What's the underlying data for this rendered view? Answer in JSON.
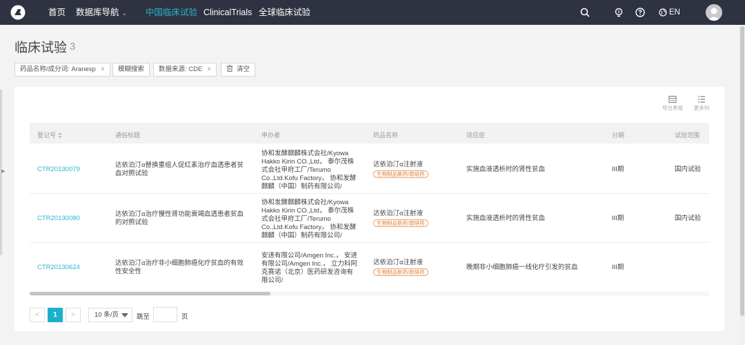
{
  "nav": {
    "home": "首页",
    "db_nav": "数据库导航",
    "cn_trials": "中国临床试验",
    "clinicaltrials": "ClinicalTrials",
    "global_trials": "全球临床试验",
    "lang": "EN"
  },
  "page": {
    "title": "临床试验",
    "count": "3"
  },
  "filters": {
    "drug": "药品名称/成分词: Aranesp",
    "fuzzy": "模糊搜索",
    "source": "数据来源: CDE",
    "clear": "清空"
  },
  "toolbar": {
    "export": "导出表格",
    "more_cols": "更多列"
  },
  "table": {
    "headers": {
      "reg": "登记号",
      "title": "通俗标题",
      "sponsor": "申办者",
      "drug": "药品名称",
      "indication": "适应症",
      "phase": "分期",
      "scope": "试验范围"
    },
    "rows": [
      {
        "reg": "CTR20130079",
        "title": "达依泊汀α替换重组人促红素治疗血透患者贫血对照试验",
        "sponsor": "协和发酵麒麟株式会社/Kyowa Hakko Kirin CO.,Ltd， 泰尔茂株式会社甲府工厂/Terumo Co.,Ltd.Kofu Factory， 协和发酵麒麟（中国）制药有限公司/",
        "drug": "达依泊汀α注射液",
        "badge": "生物制品新药/原研药",
        "indication": "实施血液透析时的肾性贫血",
        "phase": "III期",
        "scope": "国内试验"
      },
      {
        "reg": "CTR20130080",
        "title": "达依泊汀α治疗慢性肾功能衰竭血透患者贫血的对照试验",
        "sponsor": "协和发酵麒麟株式会社/Kyowa Hakko Kirin CO.,Ltd， 泰尔茂株式会社甲府工厂/Terumo Co.,Ltd.Kofu Factory， 协和发酵麒麟（中国）制药有限公司/",
        "drug": "达依泊汀α注射液",
        "badge": "生物制品新药/原研药",
        "indication": "实施血液透析时的肾性贫血",
        "phase": "III期",
        "scope": "国内试验"
      },
      {
        "reg": "CTR20130624",
        "title": "达依泊汀α治疗非小细胞肺癌化疗贫血的有效性安全性",
        "sponsor": "安进有限公司/Amgen Inc.， 安进有限公司/Amgen Inc.， 立力科阿克赛诺（北京）医药研发咨询有限公司/",
        "drug": "达依泊汀α注射液",
        "badge": "生物制品新药/原研药",
        "indication": "晚期非小细胞肺癌一线化疗引发的贫血",
        "phase": "III期",
        "scope": ""
      }
    ]
  },
  "pagination": {
    "prev": "<",
    "current": "1",
    "next": ">",
    "page_size": "10 条/页",
    "jump": "跳至",
    "page_unit": "页"
  }
}
